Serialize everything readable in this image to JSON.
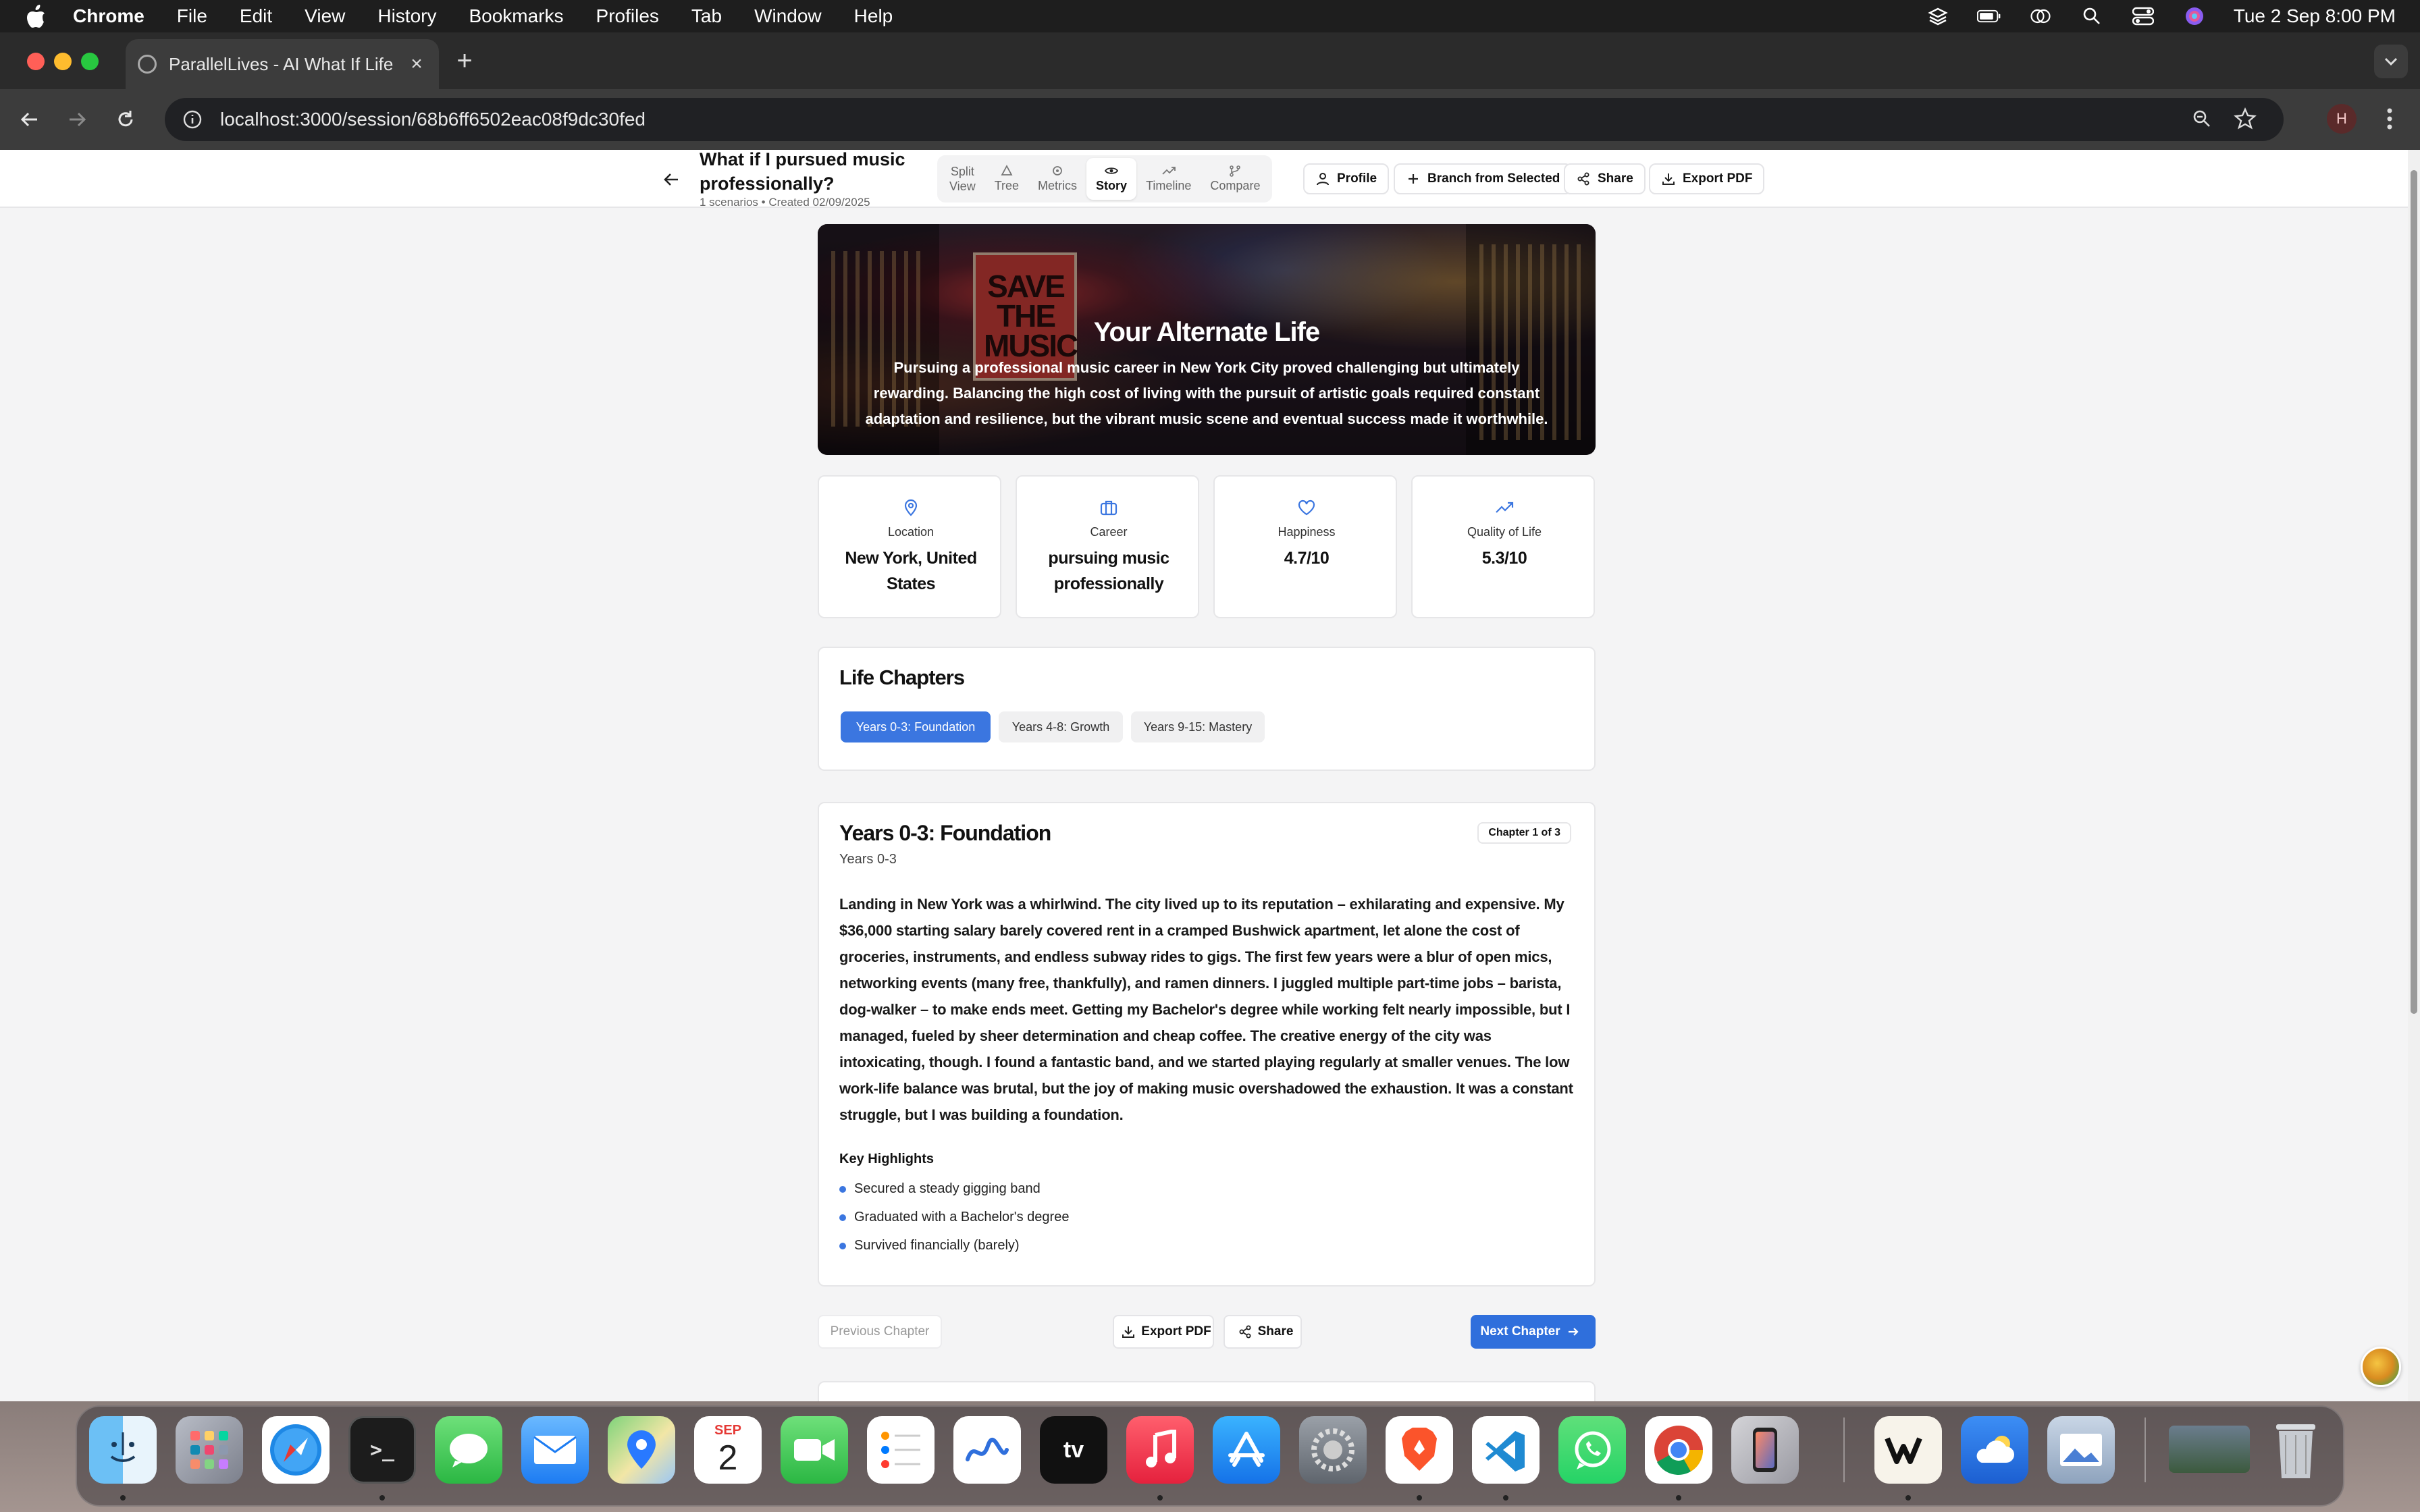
{
  "menubar": {
    "items": [
      "Chrome",
      "File",
      "Edit",
      "View",
      "History",
      "Bookmarks",
      "Profiles",
      "Tab",
      "Window",
      "Help"
    ],
    "clock": "Tue 2 Sep  8:00 PM"
  },
  "browser": {
    "tab_title": "ParallelLives - AI What If Life",
    "url": "localhost:3000/session/68b6ff6502eac08f9dc30fed",
    "profile_initial": "H"
  },
  "header": {
    "title": "What if I pursued music professionally?",
    "meta": "1 scenarios • Created 02/09/2025",
    "views": [
      {
        "label1": "Split",
        "label2": "View",
        "icon": "split-icon"
      },
      {
        "label1": "Tree",
        "icon": "tree-icon"
      },
      {
        "label1": "Metrics",
        "icon": "metrics-icon"
      },
      {
        "label1": "Story",
        "icon": "eye-icon",
        "active": true
      },
      {
        "label1": "Timeline",
        "icon": "trend-icon"
      },
      {
        "label1": "Compare",
        "icon": "branch-icon"
      }
    ],
    "profile_label": "Profile",
    "branch_label": "Branch from Selected",
    "share_label": "Share",
    "export_label": "Export PDF"
  },
  "hero": {
    "title": "Your Alternate Life",
    "subtitle": "Pursuing a professional music career in New York City proved challenging but ultimately rewarding. Balancing the high cost of living with the pursuit of artistic goals required constant adaptation and resilience, but the vibrant music scene and eventual success made it worthwhile.",
    "poster_text": "SAVE THE MUSIC"
  },
  "stats": [
    {
      "icon": "map-pin-icon",
      "label": "Location",
      "value": "New York, United States"
    },
    {
      "icon": "briefcase-icon",
      "label": "Career",
      "value": "pursuing music professionally"
    },
    {
      "icon": "heart-icon",
      "label": "Happiness",
      "value": "4.7/10"
    },
    {
      "icon": "trending-up-icon",
      "label": "Quality of Life",
      "value": "5.3/10"
    }
  ],
  "chapters": {
    "title": "Life Chapters",
    "tabs": [
      "Years 0-3: Foundation",
      "Years 4-8: Growth",
      "Years 9-15: Mastery"
    ],
    "active_index": 0
  },
  "chapter": {
    "title": "Years 0-3: Foundation",
    "years": "Years 0-3",
    "badge": "Chapter 1 of 3",
    "body": "Landing in New York was a whirlwind. The city lived up to its reputation – exhilarating and expensive. My $36,000 starting salary barely covered rent in a cramped Bushwick apartment, let alone the cost of groceries, instruments, and endless subway rides to gigs. The first few years were a blur of open mics, networking events (many free, thankfully), and ramen dinners. I juggled multiple part-time jobs – barista, dog-walker – to make ends meet. Getting my Bachelor's degree while working felt nearly impossible, but I managed, fueled by sheer determination and cheap coffee. The creative energy of the city was intoxicating, though. I found a fantastic band, and we started playing regularly at smaller venues. The low work-life balance was brutal, but the joy of making music overshadowed the exhaustion. It was a constant struggle, but I was building a foundation.",
    "highlights_title": "Key Highlights",
    "highlights": [
      "Secured a steady gigging band",
      "Graduated with a Bachelor's degree",
      "Survived financially (barely)"
    ]
  },
  "footer": {
    "prev_label": "Previous Chapter",
    "export_label": "Export PDF",
    "share_label": "Share",
    "next_label": "Next Chapter"
  },
  "dock": {
    "calendar_month": "SEP",
    "calendar_day": "2",
    "tv_label": "tv"
  },
  "colors": {
    "accent": "#3b76e0",
    "primary_button": "#2f6fdc",
    "page_bg": "#f4f4f5"
  }
}
